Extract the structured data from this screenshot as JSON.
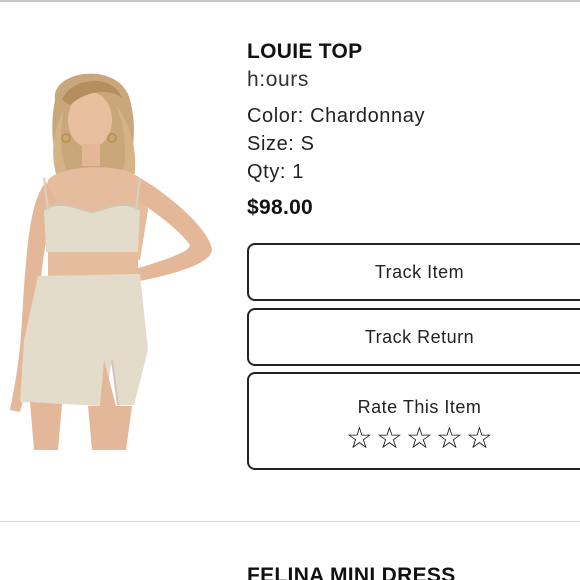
{
  "order_items": [
    {
      "name": "LOUIE TOP",
      "brand": "h:ours",
      "color": "Color: Chardonnay",
      "size": "Size: S",
      "qty": "Qty: 1",
      "price": "$98.00",
      "actions": {
        "track_item": "Track Item",
        "track_return": "Track Return",
        "rate_label": "Rate This Item",
        "rating_stars": [
          "☆",
          "☆",
          "☆",
          "☆",
          "☆"
        ],
        "rating_value": 0
      }
    },
    {
      "name": "FELINA MINI DRESS"
    }
  ],
  "colors": {
    "text": "#111111",
    "border": "#222222",
    "divider": "#c9c9c9",
    "garment": "#e3dccb"
  }
}
